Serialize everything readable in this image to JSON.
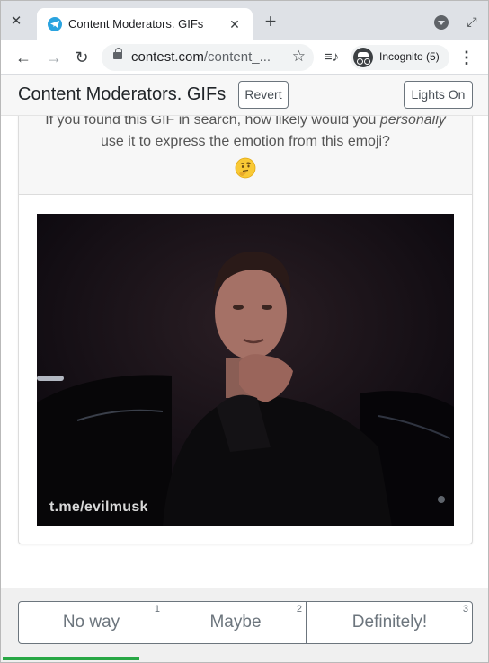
{
  "browser": {
    "tab_title": "Content Moderators. GIFs",
    "url_host": "contest.com",
    "url_path": "/content_...",
    "incognito_label": "Incognito (5)"
  },
  "header": {
    "title": "Content Moderators. GIFs",
    "revert_label": "Revert",
    "lights_label": "Lights On"
  },
  "question": {
    "text_before": "If you found this GIF in search, how likely would you ",
    "text_em": "personally",
    "text_after": " use it to express the emotion from this emoji?",
    "emoji": "thinking-face"
  },
  "gif": {
    "watermark": "t.me/evilmusk"
  },
  "answers": [
    {
      "label": "No way",
      "key": "1"
    },
    {
      "label": "Maybe",
      "key": "2"
    },
    {
      "label": "Definitely!",
      "key": "3"
    }
  ],
  "progress": {
    "fraction": 0.28
  },
  "colors": {
    "progress": "#28a745",
    "header_bg": "#f7f7f7",
    "tab_strip": "#dee1e6"
  }
}
